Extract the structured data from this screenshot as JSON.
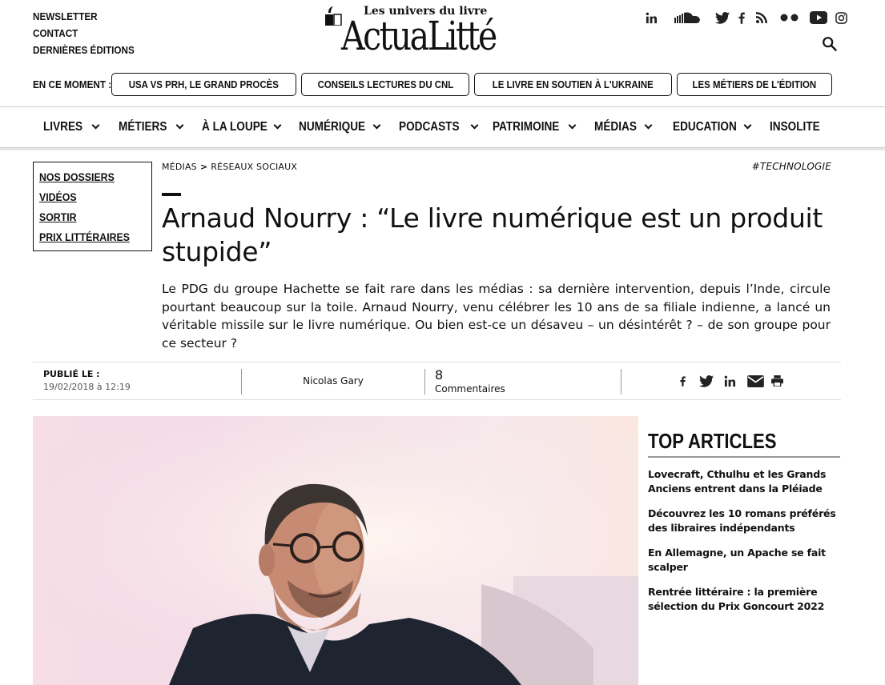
{
  "header": {
    "top_links": [
      "NEWSLETTER",
      "CONTACT",
      "DERNIÈRES ÉDITIONS"
    ],
    "logo_tagline": "Les univers du livre",
    "logo_word": "ActuaLitté",
    "social_icons": [
      "linkedin-icon",
      "soundcloud-icon",
      "twitter-icon",
      "facebook-icon",
      "rss-icon",
      "flickr-icon",
      "youtube-icon",
      "instagram-icon"
    ],
    "search_icon": "search-icon"
  },
  "trending": {
    "label": "EN CE MOMENT :",
    "items": [
      "USA VS PRH, LE GRAND PROCÈS",
      "CONSEILS LECTURES DU CNL",
      "LE LIVRE EN SOUTIEN À L'UKRAINE",
      "LES MÉTIERS DE L'ÉDITION"
    ]
  },
  "nav": {
    "items": [
      {
        "label": "LIVRES",
        "dropdown": true
      },
      {
        "label": "MÉTIERS",
        "dropdown": true
      },
      {
        "label": "À LA LOUPE",
        "dropdown": true
      },
      {
        "label": "NUMÉRIQUE",
        "dropdown": true
      },
      {
        "label": "PODCASTS",
        "dropdown": true
      },
      {
        "label": "PATRIMOINE",
        "dropdown": true
      },
      {
        "label": "MÉDIAS",
        "dropdown": true
      },
      {
        "label": "EDUCATION",
        "dropdown": true
      },
      {
        "label": "INSOLITE",
        "dropdown": false
      }
    ]
  },
  "sidebar": {
    "items": [
      "NOS DOSSIERS",
      "VIDÉOS",
      "SORTIR",
      "PRIX LITTÉRAIRES"
    ]
  },
  "article": {
    "breadcrumb": [
      "MÉDIAS",
      "RÉSEAUX SOCIAUX"
    ],
    "breadcrumb_sep": ">",
    "tag": "#TECHNOLOGIE",
    "title": "Arnaud Nourry : “Le livre numérique est un produit stupide”",
    "lede": "Le PDG du groupe Hachette se fait rare dans les médias : sa dernière intervention, depuis l’Inde, circule pourtant beaucoup sur la toile. Arnaud Nourry, venu célébrer les 10 ans de sa filiale indienne, a lancé un véritable missile sur le livre numérique. Ou bien est-ce un désaveu – un désintérêt ? – de son groupe pour ce secteur ?",
    "published_label": "PUBLIÉ LE :",
    "published_date": "19/02/2018 à 12:19",
    "author": "Nicolas Gary",
    "comments_count": "8",
    "comments_label": "Commentaires",
    "share_icons": [
      "facebook-icon",
      "twitter-icon",
      "linkedin-icon",
      "email-icon",
      "print-icon"
    ]
  },
  "top_articles": {
    "heading": "TOP ARTICLES",
    "items": [
      "Lovecraft, Cthulhu et les Grands Anciens entrent dans la Pléiade",
      "Découvrez les 10 romans préférés des libraires indépendants",
      "En Allemagne, un Apache se fait scalper",
      "Rentrée littéraire : la première sélection du Prix Goncourt 2022"
    ]
  }
}
